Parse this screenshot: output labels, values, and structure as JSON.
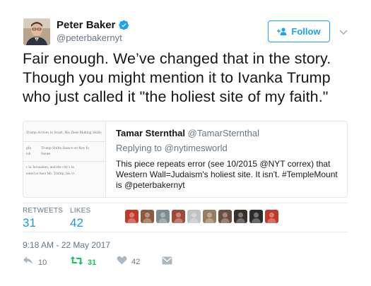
{
  "author": {
    "name": "Peter Baker",
    "handle": "@peterbakernyt",
    "verified": true
  },
  "follow_button": {
    "label": "Follow",
    "icon": "add-user-icon"
  },
  "tweet_text": "Fair enough. We’ve changed that in the story. Though you might mention it to Ivanka Trump who just called it \"the holiest site of my faith.\"",
  "quoted_tweet": {
    "author_name": "Tamar Sternthal",
    "author_handle": "@TamarSternthal",
    "replying_to_label": "Replying to",
    "replying_to_handle": "@nytimesworld",
    "text": "This piece repeats error (see 10/2015 @NYT correx) that Western Wall=Judaism's holiest site. It isn't. #TempleMount is @peterbakernyt",
    "thumbnail_lines": [
      "Trump Arrives in Israel, His Deal-Making Skills",
      "Trump Shifts Stance on Key Is",
      "Issues",
      "r in Jerusalem, and the city's la",
      "eared to host Mr. Trump, his vi"
    ]
  },
  "stats": {
    "retweets_label": "RETWEETS",
    "retweets": "31",
    "likes_label": "LIKES",
    "likes": "42"
  },
  "likers": [
    {
      "color": "#c0392b"
    },
    {
      "color": "#8e5a3c"
    },
    {
      "color": "#7f8c8d"
    },
    {
      "color": "#a04a3a"
    },
    {
      "color": "#bdc3c7"
    },
    {
      "color": "#9a7b62"
    },
    {
      "color": "#6b4e3d"
    },
    {
      "color": "#3a2f2a"
    },
    {
      "color": "#2c2c2c"
    },
    {
      "color": "#c0392b"
    }
  ],
  "timestamp": "9:18 AM - 22 May 2017",
  "actions": {
    "reply_count": "10",
    "retweet_count": "31",
    "like_count": "42"
  },
  "colors": {
    "accent": "#1da1f2",
    "retweet_green": "#17bf63",
    "muted": "#657786"
  }
}
